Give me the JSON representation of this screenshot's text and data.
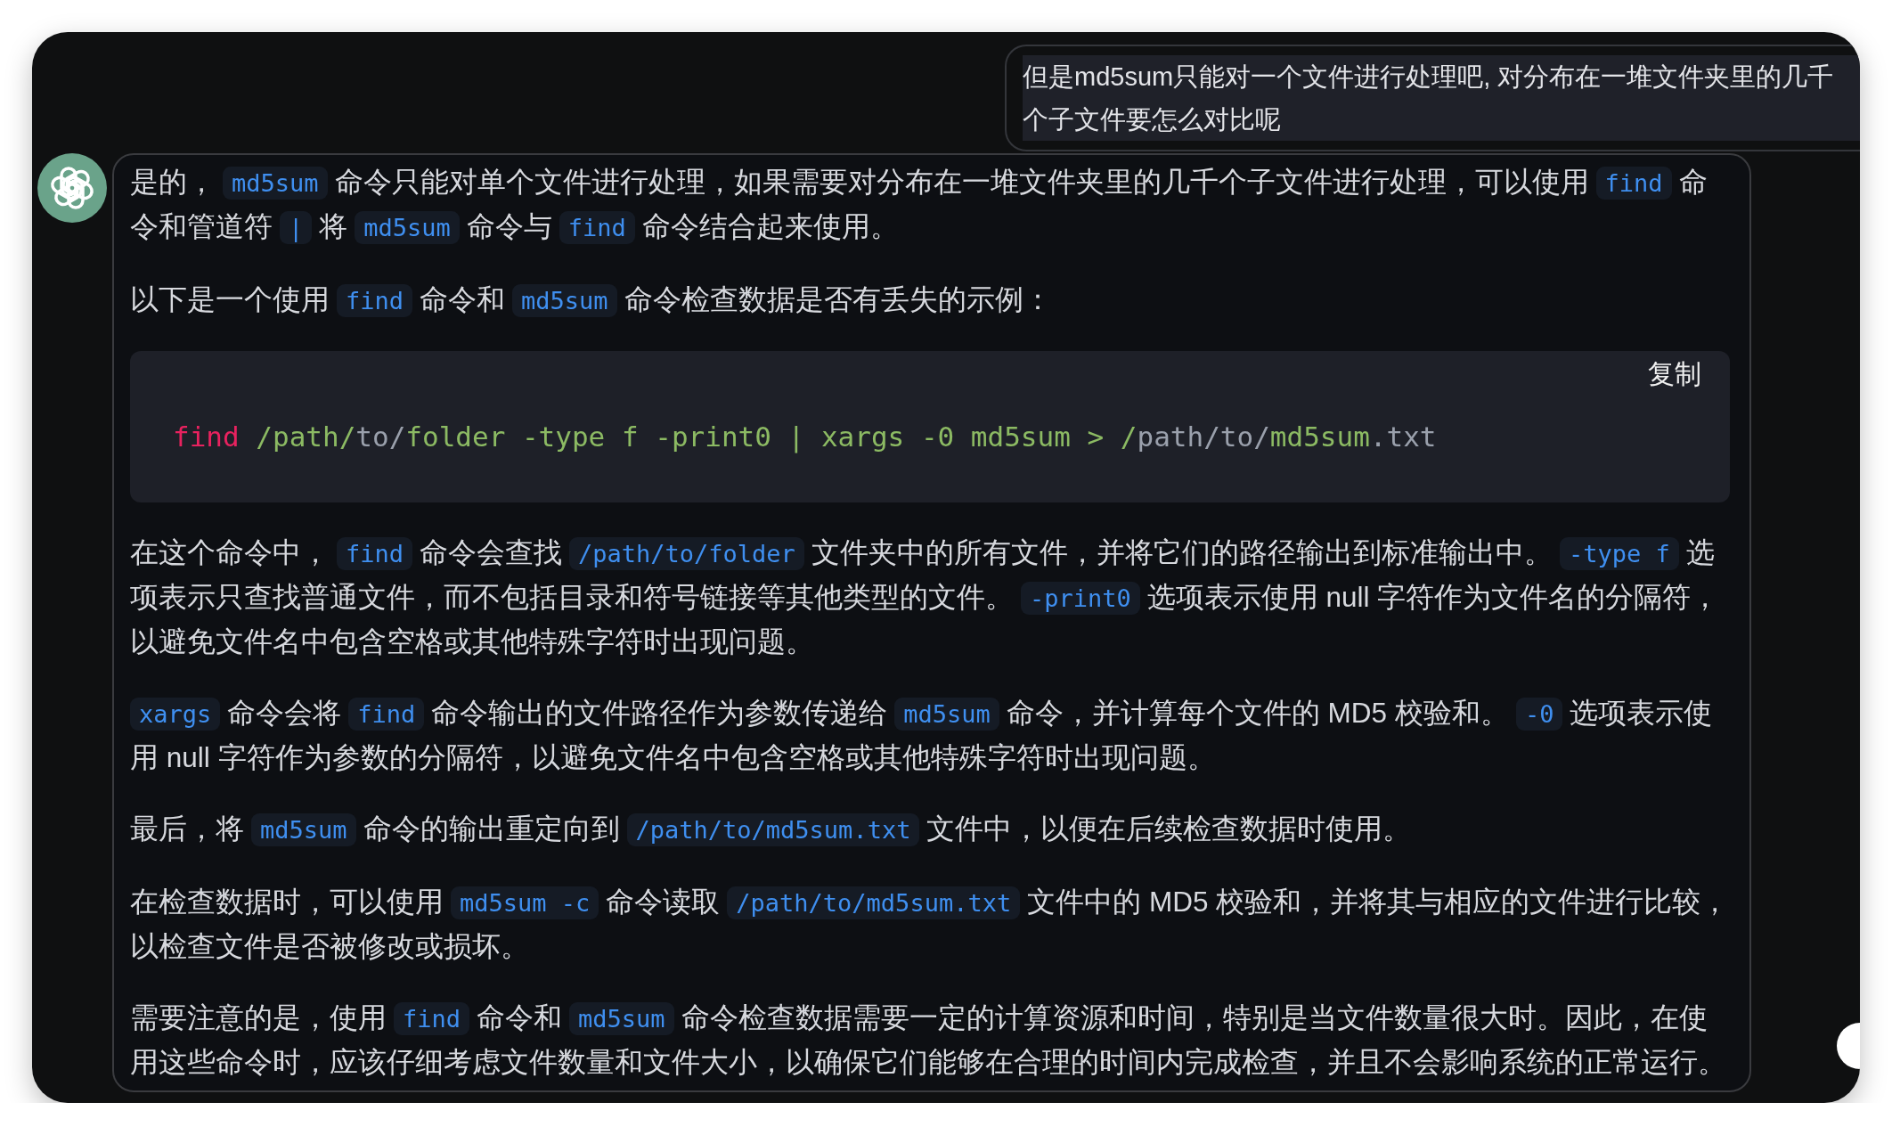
{
  "user_message": {
    "text": "但是md5sum只能对一个文件进行处理吧, 对分布在一堆文件夹里的几千个子文件要怎么对比呢"
  },
  "answer": {
    "blocks": [
      {
        "kind": "paragraph",
        "runs": [
          {
            "kind": "text",
            "text": "是的，"
          },
          {
            "kind": "code",
            "text": "md5sum"
          },
          {
            "kind": "text",
            "text": "命令只能对单个文件进行处理，如果需要对分布在一堆文件夹里的几千个子文件进行处理，可以使用"
          },
          {
            "kind": "code",
            "text": "find"
          },
          {
            "kind": "text",
            "text": "命令和管道符"
          },
          {
            "kind": "code",
            "text": "|"
          },
          {
            "kind": "text",
            "text": "将"
          },
          {
            "kind": "code",
            "text": "md5sum"
          },
          {
            "kind": "text",
            "text": "命令与"
          },
          {
            "kind": "code",
            "text": "find"
          },
          {
            "kind": "text",
            "text": "命令结合起来使用。"
          }
        ]
      },
      {
        "kind": "paragraph",
        "runs": [
          {
            "kind": "text",
            "text": "以下是一个使用"
          },
          {
            "kind": "code",
            "text": "find"
          },
          {
            "kind": "text",
            "text": "命令和"
          },
          {
            "kind": "code",
            "text": "md5sum"
          },
          {
            "kind": "text",
            "text": "命令检查数据是否有丢失的示例："
          }
        ]
      },
      {
        "kind": "code_block",
        "copy_label": "复制",
        "tokens": [
          {
            "text": "find",
            "color": "#e8225f"
          },
          {
            "text": " /path/",
            "color": "#8cba63"
          },
          {
            "text": "to/",
            "color": "#9aa0ac"
          },
          {
            "text": "folder -type f -print0 | xargs -0 md5sum > /",
            "color": "#8cba63"
          },
          {
            "text": "path/to/",
            "color": "#9aa0ac"
          },
          {
            "text": "md5sum",
            "color": "#8cba63"
          },
          {
            "text": ".txt",
            "color": "#9aa0ac"
          }
        ]
      },
      {
        "kind": "paragraph",
        "runs": [
          {
            "kind": "text",
            "text": "在这个命令中，"
          },
          {
            "kind": "code",
            "text": "find"
          },
          {
            "kind": "text",
            "text": "命令会查找"
          },
          {
            "kind": "code",
            "text": "/path/to/folder"
          },
          {
            "kind": "text",
            "text": "文件夹中的所有文件，并将它们的路径输出到标准输出中。"
          },
          {
            "kind": "code",
            "text": "-type f"
          },
          {
            "kind": "text",
            "text": "选项表示只查找普通文件，而不包括目录和符号链接等其他类型的文件。"
          },
          {
            "kind": "code",
            "text": "-print0"
          },
          {
            "kind": "text",
            "text": "选项表示使用 null 字符作为文件名的分隔符，以避免文件名中包含空格或其他特殊字符时出现问题。"
          }
        ]
      },
      {
        "kind": "paragraph",
        "runs": [
          {
            "kind": "code",
            "text": "xargs"
          },
          {
            "kind": "text",
            "text": "命令会将"
          },
          {
            "kind": "code",
            "text": "find"
          },
          {
            "kind": "text",
            "text": "命令输出的文件路径作为参数传递给"
          },
          {
            "kind": "code",
            "text": "md5sum"
          },
          {
            "kind": "text",
            "text": "命令，并计算每个文件的 MD5 校验和。"
          },
          {
            "kind": "code",
            "text": "-0"
          },
          {
            "kind": "text",
            "text": "选项表示使用 null 字符作为参数的分隔符，以避免文件名中包含空格或其他特殊字符时出现问题。"
          }
        ]
      },
      {
        "kind": "paragraph",
        "runs": [
          {
            "kind": "text",
            "text": "最后，将"
          },
          {
            "kind": "code",
            "text": "md5sum"
          },
          {
            "kind": "text",
            "text": "命令的输出重定向到"
          },
          {
            "kind": "code",
            "text": "/path/to/md5sum.txt"
          },
          {
            "kind": "text",
            "text": "文件中，以便在后续检查数据时使用。"
          }
        ]
      },
      {
        "kind": "paragraph",
        "runs": [
          {
            "kind": "text",
            "text": "在检查数据时，可以使用"
          },
          {
            "kind": "code",
            "text": "md5sum -c"
          },
          {
            "kind": "text",
            "text": "命令读取"
          },
          {
            "kind": "code",
            "text": "/path/to/md5sum.txt"
          },
          {
            "kind": "text",
            "text": "文件中的 MD5 校验和，并将其与相应的文件进行比较，以检查文件是否被修改或损坏。"
          }
        ]
      },
      {
        "kind": "paragraph",
        "runs": [
          {
            "kind": "text",
            "text": "需要注意的是，使用"
          },
          {
            "kind": "code",
            "text": "find"
          },
          {
            "kind": "text",
            "text": "命令和"
          },
          {
            "kind": "code",
            "text": "md5sum"
          },
          {
            "kind": "text",
            "text": "命令检查数据需要一定的计算资源和时间，特别是当文件数量很大时。因此，在使用这些命令时，应该仔细考虑文件数量和文件大小，以确保它们能够在合理的时间内完成检查，并且不会影响系统的正常运行。"
          }
        ]
      }
    ]
  }
}
